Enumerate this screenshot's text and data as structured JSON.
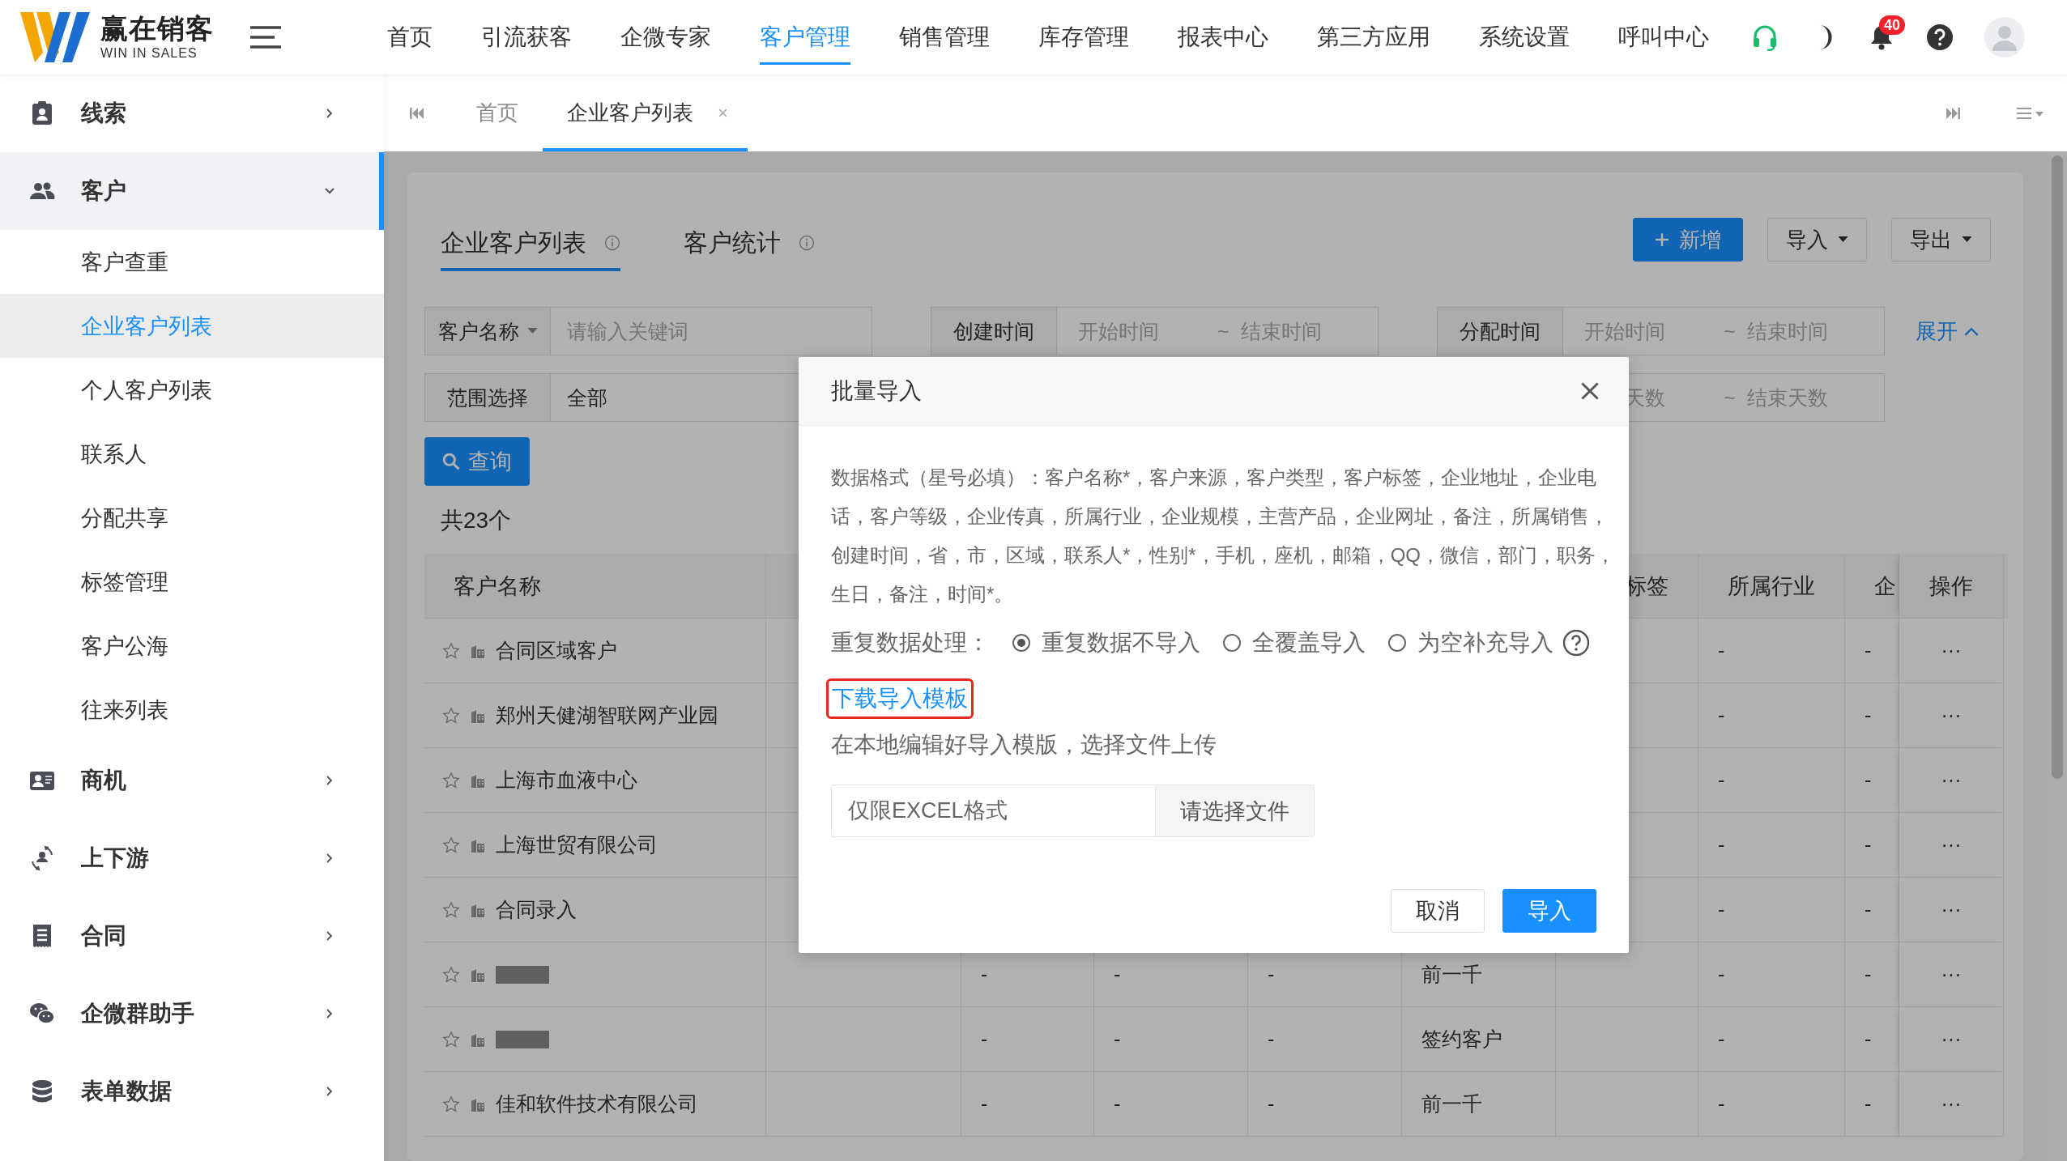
{
  "header": {
    "logo": {
      "name": "赢在销客",
      "tagline": "WIN IN SALES"
    },
    "nav": [
      {
        "label": "首页",
        "selected": false
      },
      {
        "label": "引流获客",
        "selected": false
      },
      {
        "label": "企微专家",
        "selected": false
      },
      {
        "label": "客户管理",
        "selected": true
      },
      {
        "label": "销售管理",
        "selected": false
      },
      {
        "label": "库存管理",
        "selected": false
      },
      {
        "label": "报表中心",
        "selected": false
      },
      {
        "label": "第三方应用",
        "selected": false
      },
      {
        "label": "系统设置",
        "selected": false
      },
      {
        "label": "呼叫中心",
        "selected": false
      }
    ],
    "notification_count": "40"
  },
  "sidebar": {
    "items": [
      {
        "label": "线索",
        "expanded": false
      },
      {
        "label": "客户",
        "expanded": true,
        "children": [
          {
            "label": "客户查重",
            "selected": false
          },
          {
            "label": "企业客户列表",
            "selected": true
          },
          {
            "label": "个人客户列表",
            "selected": false
          },
          {
            "label": "联系人",
            "selected": false
          },
          {
            "label": "分配共享",
            "selected": false
          },
          {
            "label": "标签管理",
            "selected": false
          },
          {
            "label": "客户公海",
            "selected": false
          },
          {
            "label": "往来列表",
            "selected": false
          }
        ]
      },
      {
        "label": "商机",
        "expanded": false
      },
      {
        "label": "上下游",
        "expanded": false
      },
      {
        "label": "合同",
        "expanded": false
      },
      {
        "label": "企微群助手",
        "expanded": false
      },
      {
        "label": "表单数据",
        "expanded": false
      }
    ]
  },
  "tabs": [
    {
      "label": "首页",
      "selected": false
    },
    {
      "label": "企业客户列表",
      "selected": true,
      "close": "×"
    }
  ],
  "page": {
    "views": [
      {
        "label": "企业客户列表",
        "selected": true
      },
      {
        "label": "客户统计",
        "selected": false
      }
    ],
    "actions": [
      {
        "label": "新增",
        "kind": "primary"
      },
      {
        "label": "导入",
        "kind": "dropdown"
      },
      {
        "label": "导出",
        "kind": "dropdown"
      }
    ],
    "filters": {
      "name_select": "客户名称",
      "keyword_placeholder": "请输入关键词",
      "created": {
        "label": "创建时间",
        "start": "开始时间",
        "sep": "~",
        "end": "结束时间"
      },
      "assigned": {
        "label": "分配时间",
        "start": "开始时间",
        "sep": "~",
        "end": "结束时间"
      },
      "expand": "展开",
      "scope": {
        "label": "范围选择",
        "value": "全部"
      },
      "days": {
        "start": "天数",
        "sep": "~",
        "end": "结束天数"
      }
    },
    "query": "查询",
    "total": "共23个",
    "table": {
      "columns": [
        "客户名称",
        "",
        "",
        "",
        "",
        "",
        "标签",
        "所属行业",
        "企",
        "操作"
      ],
      "rows": [
        {
          "starred": false,
          "name": "合同区域客户",
          "cells": [
            "",
            "",
            "",
            "",
            "",
            "",
            "-",
            "-",
            "···"
          ]
        },
        {
          "starred": false,
          "name": "郑州天健湖智联网产业园",
          "cells": [
            "",
            "",
            "",
            "",
            "",
            "",
            "-",
            "-",
            "···"
          ]
        },
        {
          "starred": false,
          "name": "上海市血液中心",
          "cells": [
            "",
            "",
            "",
            "",
            "",
            "",
            "-",
            "-",
            "···"
          ]
        },
        {
          "starred": false,
          "name": "上海世贸有限公司",
          "cells": [
            "",
            "",
            "",
            "",
            "",
            "",
            "-",
            "-",
            "···"
          ]
        },
        {
          "starred": false,
          "name": "合同录入",
          "cells": [
            "",
            "",
            "",
            "",
            "",
            "",
            "-",
            "-",
            "···"
          ]
        },
        {
          "starred": false,
          "redacted": true,
          "cells": [
            "",
            "-",
            "-",
            "-",
            "前一千",
            "",
            "-",
            "-",
            "···"
          ]
        },
        {
          "starred": false,
          "redacted": true,
          "cells": [
            "",
            "-",
            "-",
            "-",
            "签约客户",
            "",
            "-",
            "-",
            "···"
          ]
        },
        {
          "starred": false,
          "name": "佳和软件技术有限公司",
          "cells": [
            "",
            "-",
            "-",
            "-",
            "前一千",
            "",
            "-",
            "-",
            "···"
          ]
        }
      ]
    }
  },
  "dialog": {
    "title": "批量导入",
    "format_note": "数据格式（星号必填）：客户名称*，客户来源，客户类型，客户标签，企业地址，企业电话，客户等级，企业传真，所属行业，企业规模，主营产品，企业网址，备注，所属销售，创建时间，省，市，区域，联系人*，性别*，手机，座机，邮箱，QQ，微信，部门，职务，生日，备注，时间*。",
    "duplicate": {
      "label": "重复数据处理：",
      "options": [
        {
          "label": "重复数据不导入",
          "selected": true
        },
        {
          "label": "全覆盖导入",
          "selected": false
        },
        {
          "label": "为空补充导入",
          "selected": false
        }
      ]
    },
    "template_link": {
      "label": "下载导入模板",
      "highlighted": true
    },
    "hint": "在本地编辑好导入模版，选择文件上传",
    "file": {
      "placeholder": "仅限EXCEL格式",
      "button": "请选择文件"
    },
    "buttons": [
      {
        "label": "取消",
        "kind": "default"
      },
      {
        "label": "导入",
        "kind": "primary"
      }
    ]
  }
}
